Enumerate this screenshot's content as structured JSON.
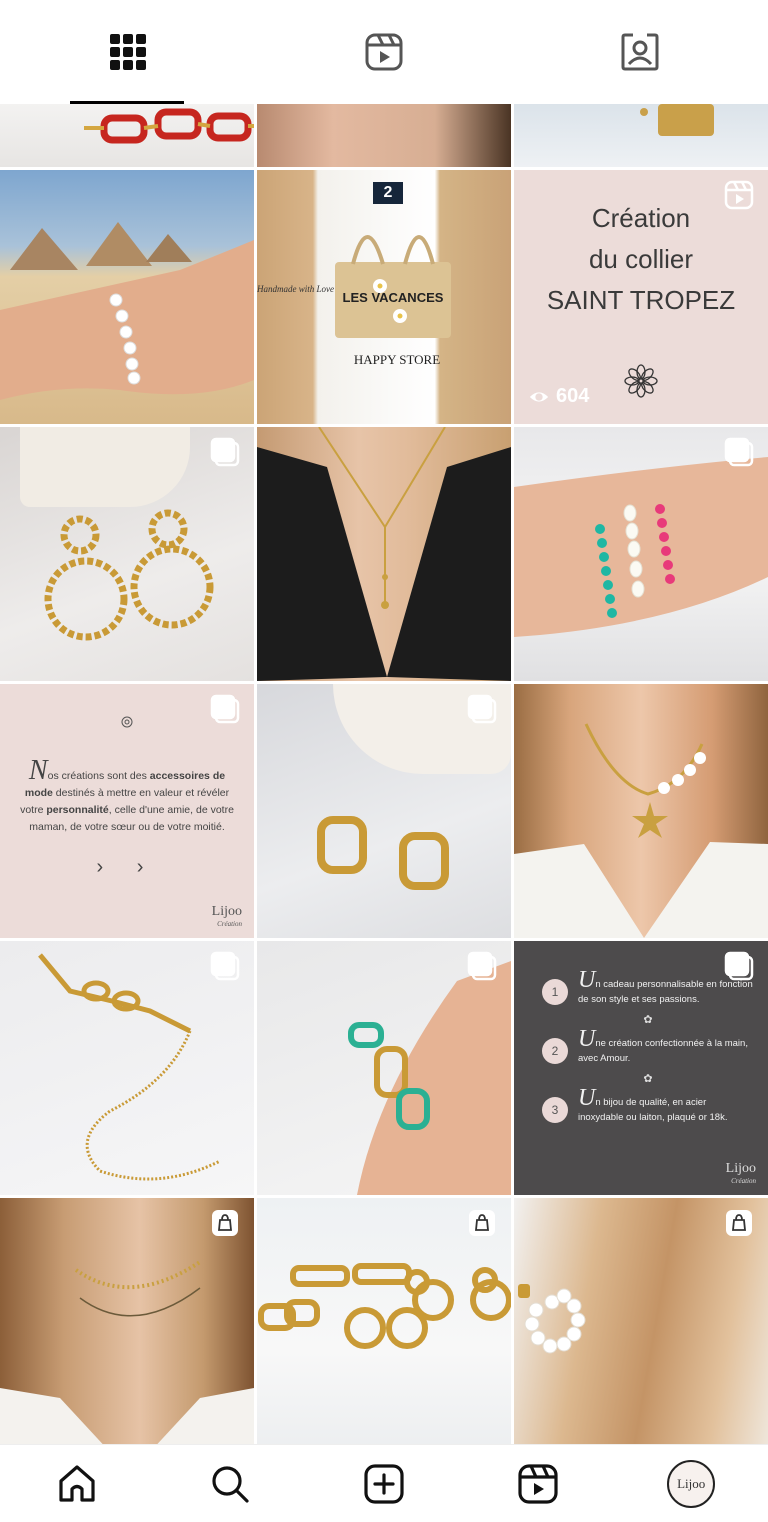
{
  "tabs": [
    {
      "name": "grid-icon",
      "active": true
    },
    {
      "name": "reels-icon",
      "active": false
    },
    {
      "name": "tagged-icon",
      "active": false
    }
  ],
  "posts": {
    "creation": {
      "line1": "Création",
      "line2": "du collier",
      "line3": "SAINT TROPEZ",
      "views": "604"
    },
    "bag": {
      "door_number": "2",
      "bag_text": "LES VACANCES",
      "store_sign": "HAPPY STORE",
      "side_text": "Handmade with Love"
    },
    "values": {
      "cap": "N",
      "text_start": "os créations sont des",
      "bold1": "accessoires de mode",
      "text_mid": "destinés à mettre en valeur et révéler votre",
      "bold2": "personnalité",
      "text_end": ", celle d'une amie, de votre maman, de votre sœur ou de votre moitié.",
      "arrows": "› ›",
      "logo": "Lijoo",
      "logo_sub": "Création"
    },
    "promises": {
      "items": [
        {
          "num": "1",
          "cap": "U",
          "text": "n cadeau personnalisable en fonction de son style et ses passions."
        },
        {
          "num": "2",
          "cap": "U",
          "text": "ne création confectionnée à la main, avec Amour."
        },
        {
          "num": "3",
          "cap": "U",
          "text": "n bijou de qualité, en acier inoxydable ou laiton, plaqué or 18k."
        }
      ],
      "logo": "Lijoo",
      "logo_sub": "Création"
    }
  },
  "bottom_nav": {
    "items": [
      "home-icon",
      "search-icon",
      "create-icon",
      "reels-icon",
      "profile-avatar"
    ],
    "avatar_text": "Lijoo"
  },
  "colors": {
    "pink_card": "#ecdcd9",
    "dark_card": "#4d4b4c",
    "accent": "#000000"
  }
}
